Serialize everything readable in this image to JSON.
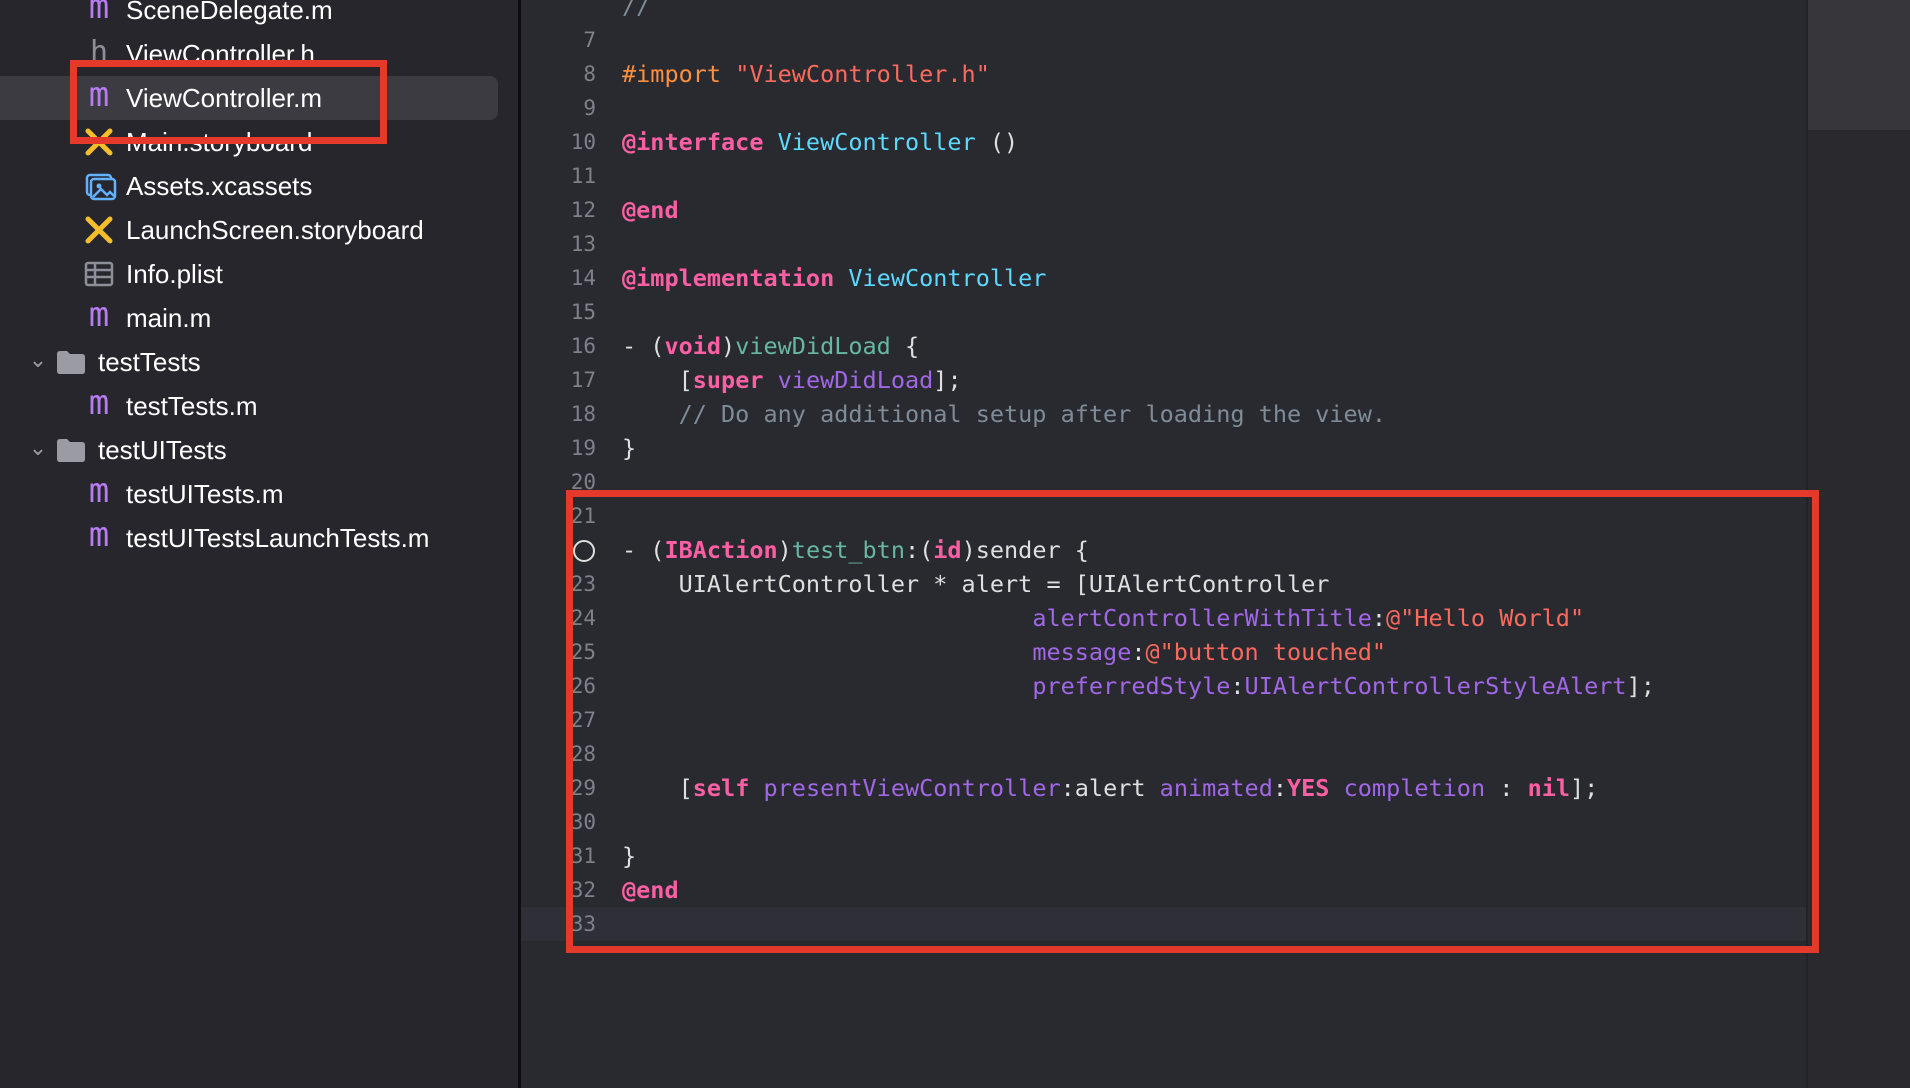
{
  "navigator": {
    "items": [
      {
        "label": "SceneDelegate.m",
        "icon": "m-file-icon"
      },
      {
        "label": "ViewController.h",
        "icon": "h-file-icon"
      },
      {
        "label": "ViewController.m",
        "icon": "m-file-icon",
        "selected": true
      },
      {
        "label": "Main.storyboard",
        "icon": "storyboard-icon"
      },
      {
        "label": "Assets.xcassets",
        "icon": "assets-icon"
      },
      {
        "label": "LaunchScreen.storyboard",
        "icon": "storyboard-icon"
      },
      {
        "label": "Info.plist",
        "icon": "plist-icon"
      },
      {
        "label": "main.m",
        "icon": "m-file-icon"
      },
      {
        "label": "testTests",
        "icon": "folder-icon",
        "expanded": true
      },
      {
        "label": "testTests.m",
        "icon": "m-file-icon"
      },
      {
        "label": "testUITests",
        "icon": "folder-icon",
        "expanded": true
      },
      {
        "label": "testUITests.m",
        "icon": "m-file-icon"
      },
      {
        "label": "testUITestsLaunchTests.m",
        "icon": "m-file-icon"
      }
    ],
    "icon_glyphs": {
      "m": "m",
      "h": "h",
      "chevron": "⌄"
    }
  },
  "editor": {
    "current_line": "33",
    "lines": [
      {
        "n": "",
        "tokens": [
          [
            "cmt",
            "//"
          ]
        ]
      },
      {
        "n": "7",
        "tokens": []
      },
      {
        "n": "8",
        "tokens": [
          [
            "pp",
            "#import "
          ],
          [
            "str",
            "\"ViewController.h\""
          ]
        ]
      },
      {
        "n": "9",
        "tokens": []
      },
      {
        "n": "10",
        "tokens": [
          [
            "kw",
            "@interface "
          ],
          [
            "type",
            "ViewController"
          ],
          [
            "plain",
            " ()"
          ]
        ]
      },
      {
        "n": "11",
        "tokens": []
      },
      {
        "n": "12",
        "tokens": [
          [
            "kw",
            "@end"
          ]
        ]
      },
      {
        "n": "13",
        "tokens": []
      },
      {
        "n": "14",
        "tokens": [
          [
            "kw",
            "@implementation "
          ],
          [
            "type",
            "ViewController"
          ]
        ]
      },
      {
        "n": "15",
        "tokens": []
      },
      {
        "n": "16",
        "tokens": [
          [
            "plain",
            "- ("
          ],
          [
            "kw",
            "void"
          ],
          [
            "plain",
            ")"
          ],
          [
            "fn",
            "viewDidLoad"
          ],
          [
            "plain",
            " {"
          ]
        ]
      },
      {
        "n": "17",
        "tokens": [
          [
            "plain",
            "    ["
          ],
          [
            "kw",
            "super"
          ],
          [
            "plain",
            " "
          ],
          [
            "mth",
            "viewDidLoad"
          ],
          [
            "plain",
            "];"
          ]
        ]
      },
      {
        "n": "18",
        "tokens": [
          [
            "cmt",
            "    // Do any additional setup after loading the view."
          ]
        ]
      },
      {
        "n": "19",
        "tokens": [
          [
            "plain",
            "}"
          ]
        ]
      },
      {
        "n": "20",
        "tokens": []
      },
      {
        "n": "21",
        "tokens": []
      },
      {
        "n": "",
        "breakpoint": true,
        "tokens": [
          [
            "plain",
            "- ("
          ],
          [
            "kw",
            "IBAction"
          ],
          [
            "plain",
            ")"
          ],
          [
            "fn",
            "test_btn"
          ],
          [
            "plain",
            ":("
          ],
          [
            "kw",
            "id"
          ],
          [
            "plain",
            ")sender {"
          ]
        ]
      },
      {
        "n": "23",
        "tokens": [
          [
            "plain",
            "    UIAlertController * alert = [UIAlertController"
          ]
        ]
      },
      {
        "n": "24",
        "tokens": [
          [
            "plain",
            "                             "
          ],
          [
            "mth",
            "alertControllerWithTitle"
          ],
          [
            "plain",
            ":"
          ],
          [
            "str",
            "@\"Hello World\""
          ]
        ]
      },
      {
        "n": "25",
        "tokens": [
          [
            "plain",
            "                             "
          ],
          [
            "mth",
            "message"
          ],
          [
            "plain",
            ":"
          ],
          [
            "str",
            "@\"button touched\""
          ]
        ]
      },
      {
        "n": "26",
        "tokens": [
          [
            "plain",
            "                             "
          ],
          [
            "mth",
            "preferredStyle"
          ],
          [
            "plain",
            ":"
          ],
          [
            "mth",
            "UIAlertControllerStyleAlert"
          ],
          [
            "plain",
            "];"
          ]
        ]
      },
      {
        "n": "27",
        "tokens": []
      },
      {
        "n": "28",
        "tokens": []
      },
      {
        "n": "29",
        "tokens": [
          [
            "plain",
            "    ["
          ],
          [
            "kw",
            "self"
          ],
          [
            "plain",
            " "
          ],
          [
            "mth",
            "presentViewController"
          ],
          [
            "plain",
            ":alert "
          ],
          [
            "mth",
            "animated"
          ],
          [
            "plain",
            ":"
          ],
          [
            "kw",
            "YES"
          ],
          [
            "plain",
            " "
          ],
          [
            "mth",
            "completion"
          ],
          [
            "plain",
            " : "
          ],
          [
            "kw",
            "nil"
          ],
          [
            "plain",
            "];"
          ]
        ]
      },
      {
        "n": "30",
        "tokens": []
      },
      {
        "n": "31",
        "tokens": [
          [
            "plain",
            "}"
          ]
        ]
      },
      {
        "n": "32",
        "tokens": [
          [
            "kw",
            "@end"
          ]
        ]
      },
      {
        "n": "33",
        "tokens": []
      }
    ]
  },
  "colors": {
    "annotation_red": "#e5392b",
    "keyword": "#fc5fa3",
    "string": "#fc6a5d",
    "preprocessor": "#fd8f3f",
    "type": "#5dd8ff",
    "method": "#a167e6",
    "comment": "#7f8c98",
    "function_decl": "#67b7a4"
  }
}
